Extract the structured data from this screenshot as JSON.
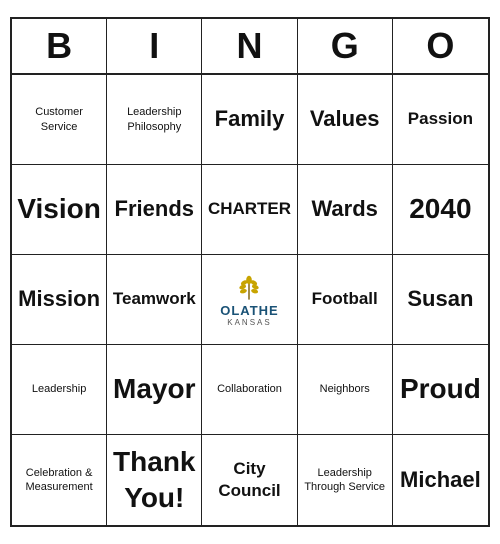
{
  "header": {
    "letters": [
      "B",
      "I",
      "N",
      "G",
      "O"
    ]
  },
  "cells": [
    {
      "id": "r1c1",
      "text": "Customer Service",
      "size": "small",
      "lines": 2
    },
    {
      "id": "r1c2",
      "text": "Leadership Philosophy",
      "size": "small",
      "lines": 2
    },
    {
      "id": "r1c3",
      "text": "Family",
      "size": "large"
    },
    {
      "id": "r1c4",
      "text": "Values",
      "size": "large"
    },
    {
      "id": "r1c5",
      "text": "Passion",
      "size": "medium"
    },
    {
      "id": "r2c1",
      "text": "Vision",
      "size": "xlarge"
    },
    {
      "id": "r2c2",
      "text": "Friends",
      "size": "large"
    },
    {
      "id": "r2c3",
      "text": "CHARTER",
      "size": "medium"
    },
    {
      "id": "r2c4",
      "text": "Wards",
      "size": "large"
    },
    {
      "id": "r2c5",
      "text": "2040",
      "size": "xlarge"
    },
    {
      "id": "r3c1",
      "text": "Mission",
      "size": "large"
    },
    {
      "id": "r3c2",
      "text": "Teamwork",
      "size": "medium"
    },
    {
      "id": "r3c3",
      "text": "OLATHE",
      "size": "logo"
    },
    {
      "id": "r3c4",
      "text": "Football",
      "size": "medium"
    },
    {
      "id": "r3c5",
      "text": "Susan",
      "size": "large"
    },
    {
      "id": "r4c1",
      "text": "Leadership",
      "size": "small"
    },
    {
      "id": "r4c2",
      "text": "Mayor",
      "size": "xlarge"
    },
    {
      "id": "r4c3",
      "text": "Collaboration",
      "size": "small"
    },
    {
      "id": "r4c4",
      "text": "Neighbors",
      "size": "small"
    },
    {
      "id": "r4c5",
      "text": "Proud",
      "size": "xlarge"
    },
    {
      "id": "r5c1",
      "text": "Celebration &\nMeasurement",
      "size": "small"
    },
    {
      "id": "r5c2",
      "text": "Thank You!",
      "size": "xlarge"
    },
    {
      "id": "r5c3",
      "text": "City Council",
      "size": "medium"
    },
    {
      "id": "r5c4",
      "text": "Leadership Through Service",
      "size": "small"
    },
    {
      "id": "r5c5",
      "text": "Michael",
      "size": "large"
    }
  ]
}
